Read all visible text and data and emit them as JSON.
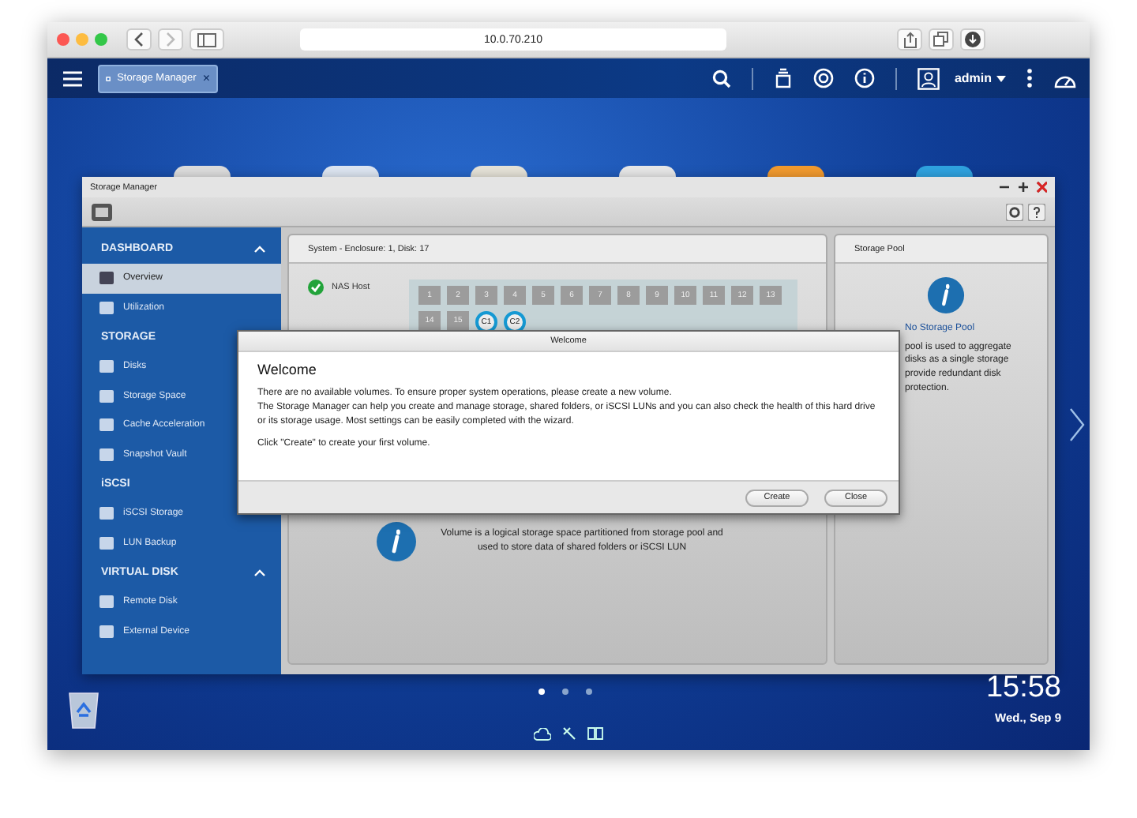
{
  "browser": {
    "url": "10.0.70.210"
  },
  "topbar": {
    "tab": {
      "label": "Storage Manager",
      "close": "×"
    },
    "user": "admin"
  },
  "app": {
    "title": "Storage Manager",
    "sidebar": [
      {
        "heading": "DASHBOARD",
        "expanded": true,
        "items": [
          {
            "label": "Overview",
            "selected": true
          },
          {
            "label": "Utilization",
            "selected": false
          }
        ]
      },
      {
        "heading": "STORAGE",
        "items": [
          {
            "label": "Disks",
            "selected": false
          },
          {
            "label": "Storage Space",
            "selected": false
          },
          {
            "label": "Cache Acceleration",
            "selected": false
          },
          {
            "label": "Snapshot Vault",
            "selected": false
          }
        ]
      },
      {
        "heading": "iSCSI",
        "items": [
          {
            "label": "iSCSI Storage",
            "selected": false
          },
          {
            "label": "LUN Backup",
            "selected": false
          }
        ]
      },
      {
        "heading": "VIRTUAL DISK",
        "expanded": true,
        "items": [
          {
            "label": "Remote Disk",
            "selected": false
          },
          {
            "label": "External Device",
            "selected": false
          }
        ]
      }
    ],
    "system": {
      "title": "System - Enclosure: 1, Disk: 17",
      "host": "NAS Host",
      "disks": [
        {
          "label": "1",
          "kind": "bay"
        },
        {
          "label": "2",
          "kind": "bay"
        },
        {
          "label": "3",
          "kind": "bay"
        },
        {
          "label": "4",
          "kind": "bay"
        },
        {
          "label": "5",
          "kind": "bay"
        },
        {
          "label": "6",
          "kind": "bay"
        },
        {
          "label": "7",
          "kind": "bay"
        },
        {
          "label": "8",
          "kind": "bay"
        },
        {
          "label": "9",
          "kind": "bay"
        },
        {
          "label": "10",
          "kind": "bay"
        },
        {
          "label": "11",
          "kind": "bay"
        },
        {
          "label": "12",
          "kind": "bay"
        },
        {
          "label": "13",
          "kind": "bay"
        },
        {
          "label": "14",
          "kind": "bay"
        },
        {
          "label": "15",
          "kind": "bay"
        },
        {
          "label": "C1",
          "kind": "cache"
        },
        {
          "label": "C2",
          "kind": "cache"
        }
      ],
      "volume_info": "Volume is a logical storage space partitioned from storage pool and used to store data of shared folders or iSCSI LUN"
    },
    "pool": {
      "title": "Storage Pool",
      "heading": "No Storage Pool",
      "lines": [
        "pool is used to aggregate",
        "disks as a single storage",
        "provide redundant disk",
        "protection."
      ]
    }
  },
  "dialog": {
    "title": "Welcome",
    "heading": "Welcome",
    "paragraphs": [
      "There are no available volumes. To ensure proper system operations, please create a new volume.",
      "The Storage Manager can help you create and manage storage, shared folders, or iSCSI LUNs and you can also check the health of this hard drive or its storage usage. Most settings can be easily completed with the wizard."
    ],
    "note": "Click \"Create\" to create your first volume.",
    "buttons": [
      "Create",
      "Close"
    ]
  },
  "desktop": {
    "pages": [
      {
        "selected": true
      },
      {
        "selected": false
      },
      {
        "selected": false
      }
    ],
    "time": "15:58",
    "date": "Wed., Sep 9"
  }
}
